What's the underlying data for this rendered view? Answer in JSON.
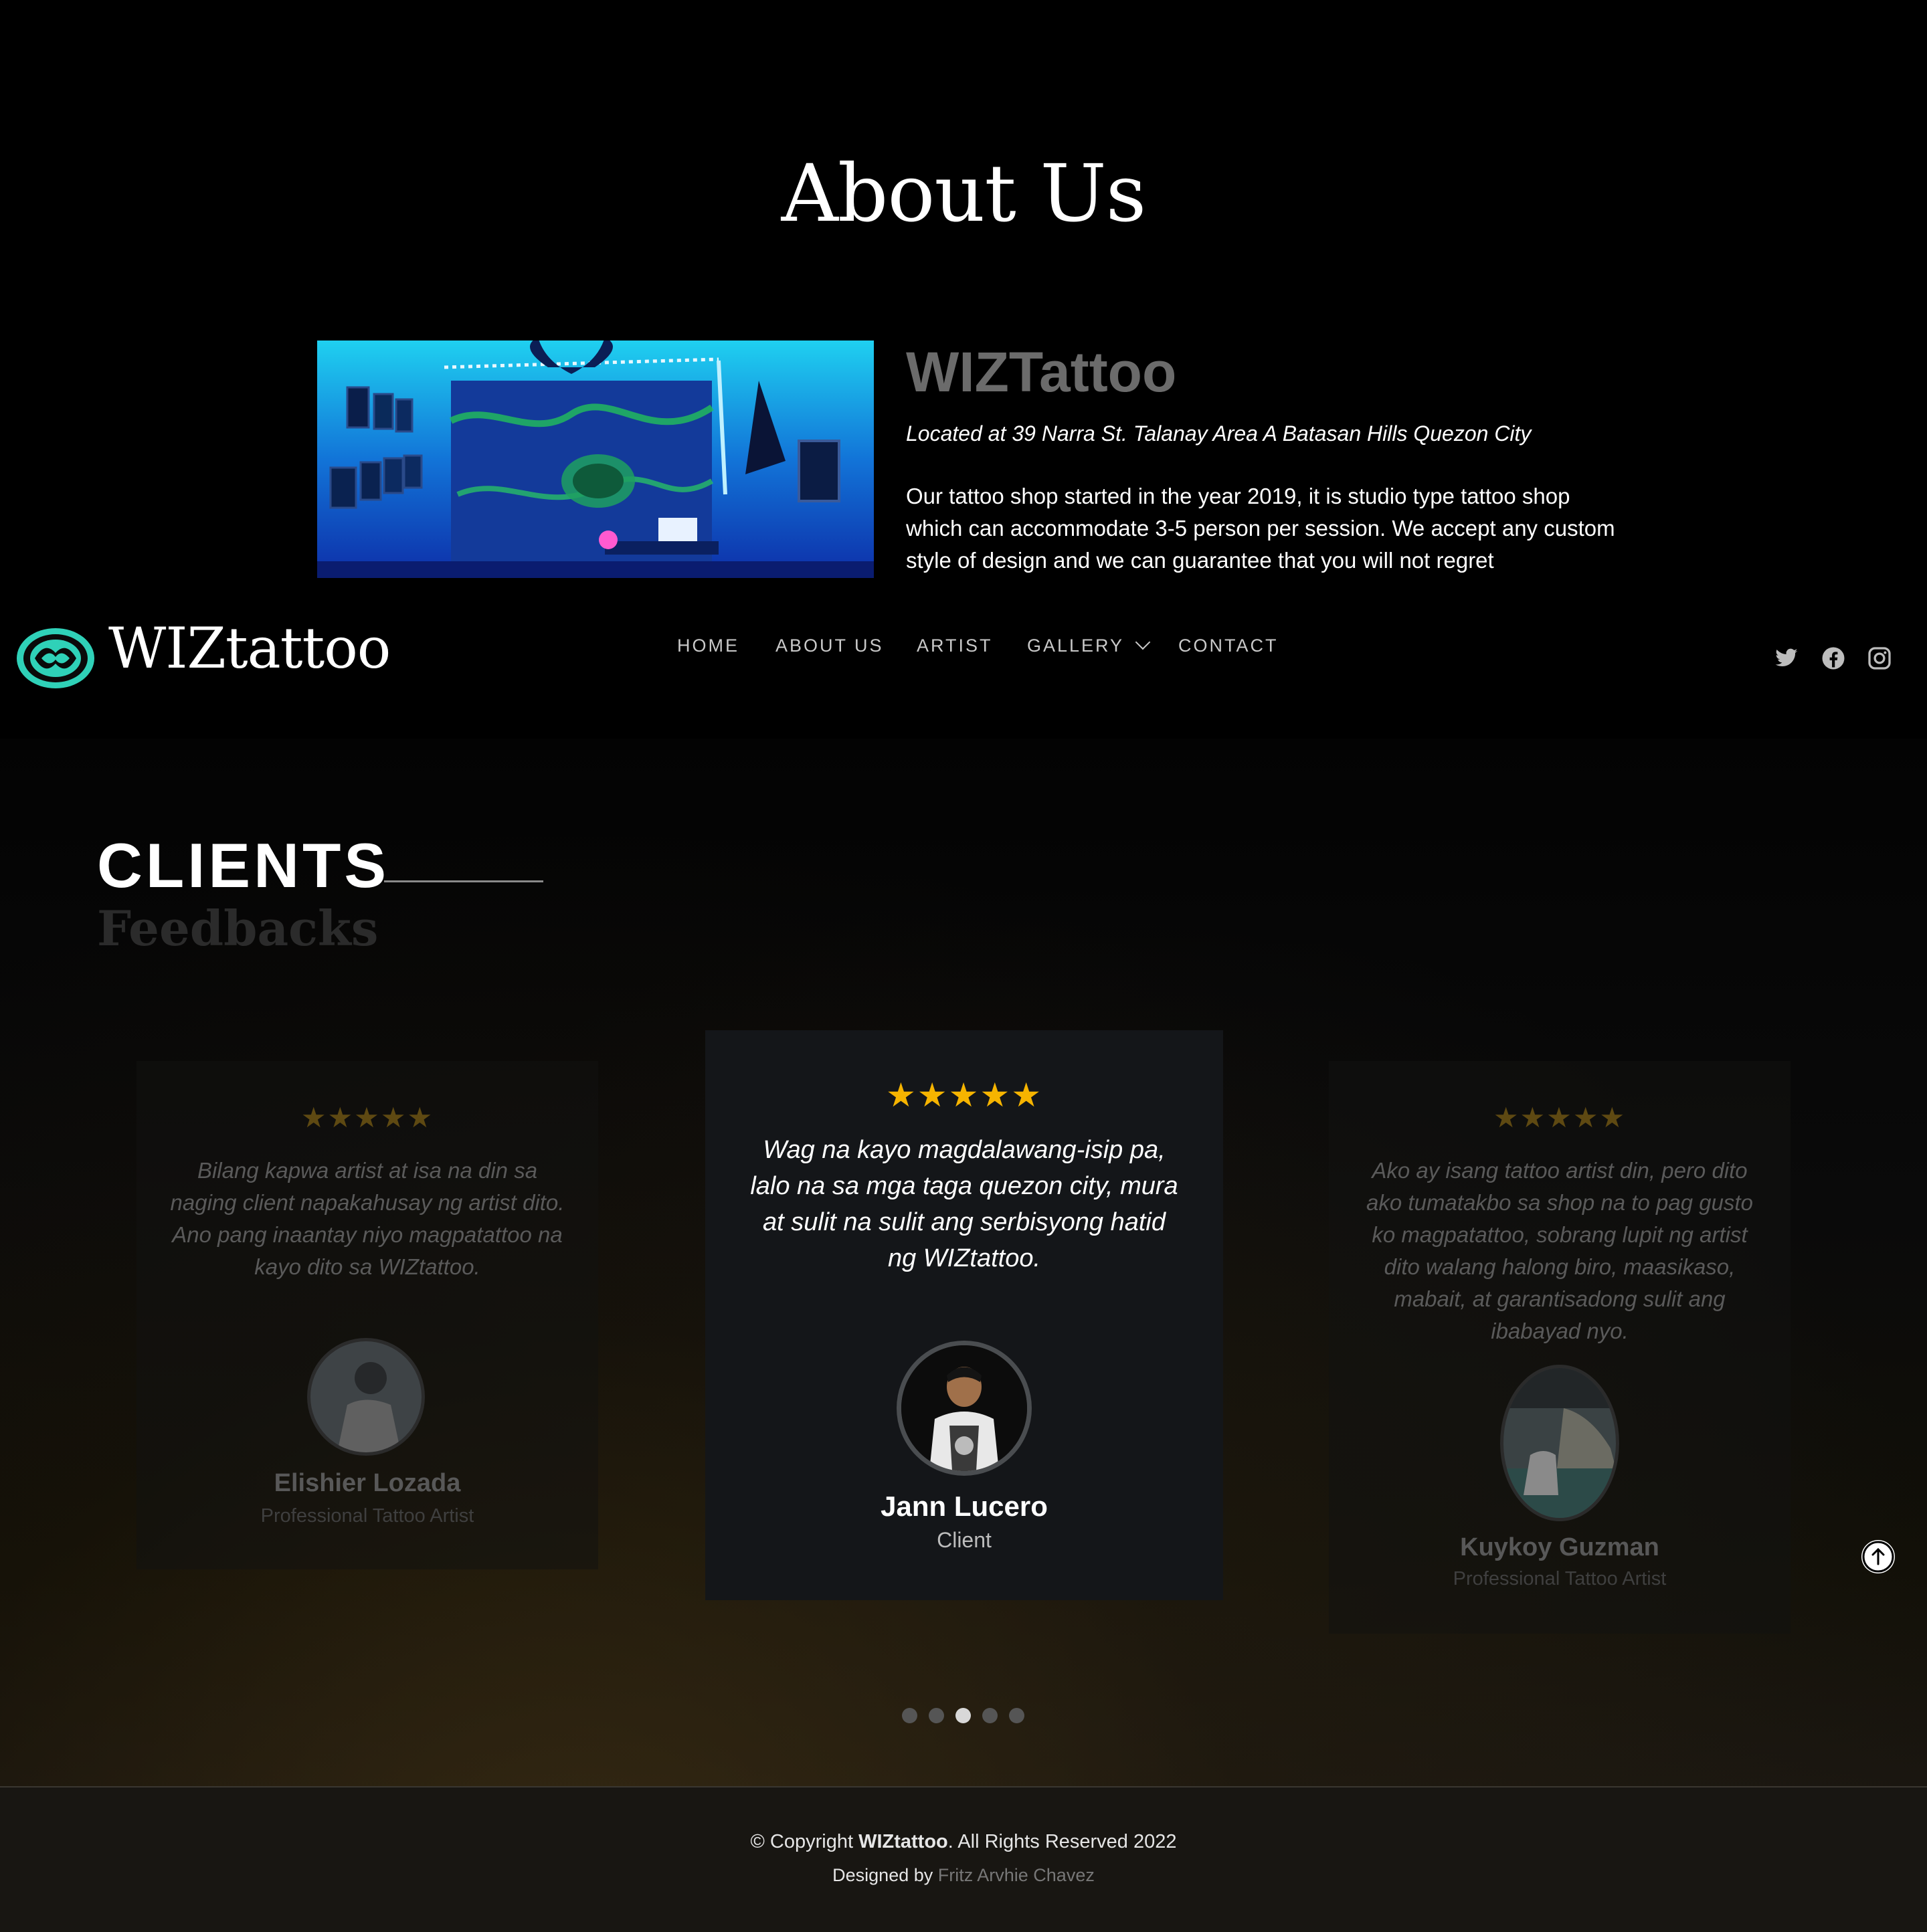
{
  "about": {
    "title": "About Us",
    "name": "WIZTattoo",
    "location": "Located at 39 Narra St. Talanay Area A Batasan Hills Quezon City",
    "description": "Our tattoo shop started in the year 2019, it is studio type tattoo shop which can accommodate 3-5 person per session. We accept any custom style of design and we can guarantee that you will not regret"
  },
  "header": {
    "logo_text": "WIZtattoo",
    "nav": {
      "home": "HOME",
      "about": "ABOUT US",
      "artist": "ARTIST",
      "gallery": "GALLERY",
      "contact": "CONTACT"
    },
    "social_icons": [
      "twitter-icon",
      "facebook-icon",
      "instagram-icon"
    ]
  },
  "clients": {
    "heading": "CLIENTS",
    "subheading": "Feedbacks",
    "rating_stars": "★★★★★",
    "cards": [
      {
        "quote": "Bilang kapwa artist at isa na din sa naging client napakahusay ng artist dito. Ano pang inaantay niyo magpatattoo na kayo dito sa WIZtattoo.",
        "name": "Elishier Lozada",
        "role": "Professional Tattoo Artist"
      },
      {
        "quote": "Wag na kayo magdalawang-isip pa, lalo na sa mga taga quezon city, mura at sulit na sulit ang serbisyong hatid ng WIZtattoo.",
        "name": "Jann Lucero",
        "role": "Client"
      },
      {
        "quote": "Ako ay isang tattoo artist din, pero dito ako tumatakbo sa shop na to pag gusto ko magpatattoo, sobrang lupit ng artist dito walang halong biro, maasikaso, mabait, at garantisadong sulit ang ibabayad nyo.",
        "name": "Kuykoy Guzman",
        "role": "Professional Tattoo Artist"
      }
    ],
    "pagination": {
      "total": 5,
      "active": 3
    }
  },
  "footer": {
    "copyright_prefix": "© Copyright ",
    "brand": "WIZtattoo",
    "copyright_suffix": ". All Rights Reserved 2022",
    "designed_prefix": "Designed by ",
    "designer": "Fritz Arvhie Chavez"
  },
  "colors": {
    "accent_star": "#f6b400",
    "logo_teal": "#2fd1b8",
    "background": "#000000"
  }
}
